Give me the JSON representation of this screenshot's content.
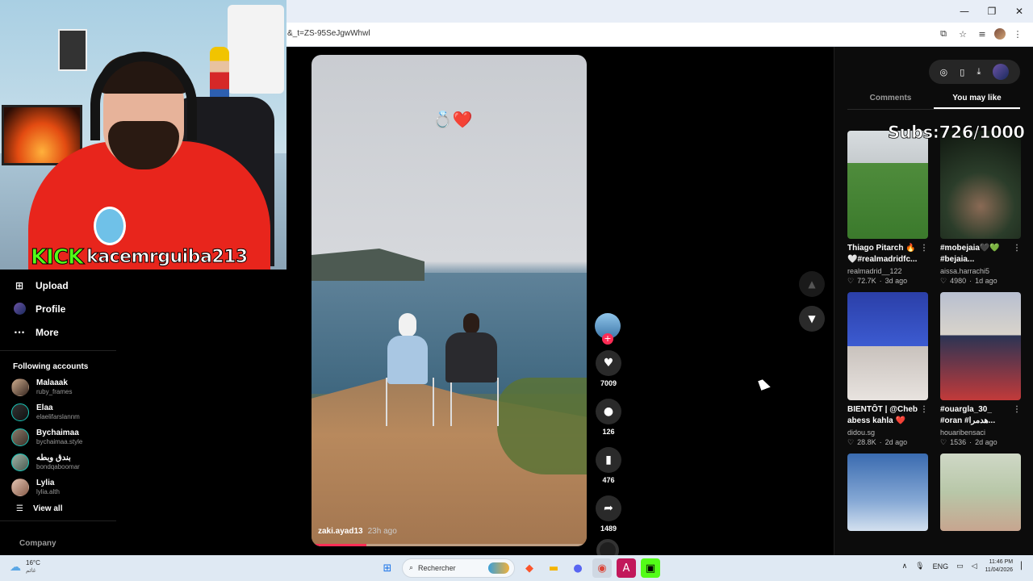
{
  "browser": {
    "url": "&_t=ZS-95SeJgwWhwl",
    "window_controls": [
      "—",
      "❐",
      "✕"
    ]
  },
  "stream": {
    "platform": "KICK",
    "username": "kacemrguiba213"
  },
  "sidebar": {
    "nav": [
      {
        "label": "Upload",
        "icon": "plus-square-icon"
      },
      {
        "label": "Profile",
        "icon": "profile-avatar-icon"
      },
      {
        "label": "More",
        "icon": "ellipsis-icon"
      }
    ],
    "following_title": "Following accounts",
    "accounts": [
      {
        "name": "Malaaak",
        "handle": "ruby_frames"
      },
      {
        "name": "Elaa",
        "handle": "elaelifarslannm"
      },
      {
        "name": "Bychaimaa",
        "handle": "bychaimaa.style"
      },
      {
        "name": "بندق وبطه",
        "handle": "bondqaboomar"
      },
      {
        "name": "Lylia",
        "handle": "lylia.alth"
      }
    ],
    "view_all": "View all",
    "company": "Company"
  },
  "video": {
    "caption": "💍❤️",
    "author": "zaki.ayad13",
    "time": "23h ago",
    "progress": 0.2
  },
  "actions": {
    "likes": "7009",
    "comments": "126",
    "saves": "476",
    "shares": "1489"
  },
  "right_panel": {
    "tabs": [
      "Comments",
      "You may like"
    ],
    "active_tab": "You may like",
    "overlay_text": "Subs:726/1000",
    "cards": [
      {
        "title": "Thiago Pitarch 🔥 🤍#realmadridfc...",
        "author": "realmadrid__122",
        "likes": "72.7K",
        "age": "3d ago"
      },
      {
        "title": "#mobejaia🖤💚 #bejaia...",
        "author": "aissa.harrachi5",
        "likes": "4980",
        "age": "1d ago"
      },
      {
        "title": "BIENTÔT | @Cheb abess kahla ❤️",
        "author": "didou.sg",
        "likes": "28.8K",
        "age": "2d ago"
      },
      {
        "title": "#ouargla_30_ #oran #هدمرا...",
        "author": "houaribensaci",
        "likes": "1536",
        "age": "2d ago"
      },
      {
        "title": "",
        "author": "",
        "likes": "",
        "age": ""
      },
      {
        "title": "",
        "author": "",
        "likes": "",
        "age": ""
      }
    ]
  },
  "taskbar": {
    "temp": "16°C",
    "condition": "غائم",
    "search_placeholder": "Rechercher",
    "lang": "ENG",
    "time": "11:46 PM",
    "date": "11/04/2026"
  }
}
